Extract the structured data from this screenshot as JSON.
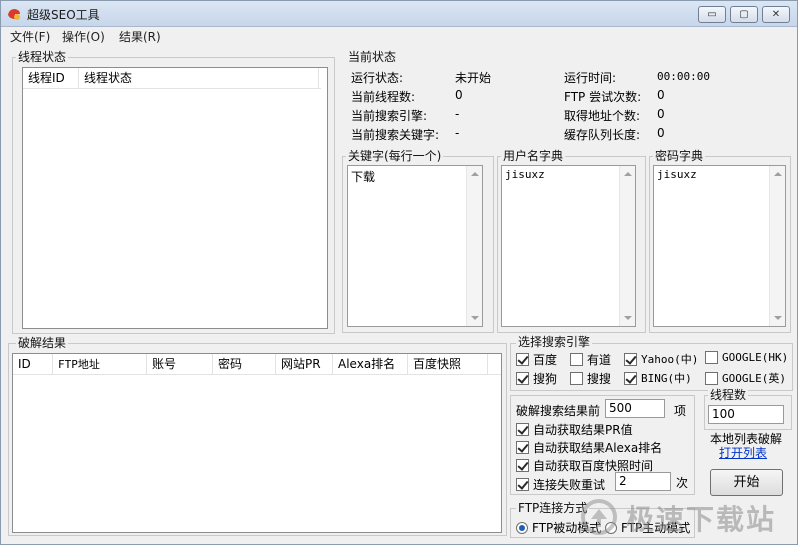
{
  "window": {
    "title": "超级SEO工具",
    "controls": {
      "minimize": "▭",
      "maximize": "▢",
      "close": "✕"
    }
  },
  "menu": [
    "文件(F)",
    "操作(O)",
    "结果(R)"
  ],
  "thread_status": {
    "label": "线程状态",
    "columns": [
      "线程ID",
      "线程状态"
    ]
  },
  "current_status": {
    "label": "当前状态",
    "left": [
      {
        "key": "运行状态:",
        "value": "未开始"
      },
      {
        "key": "当前线程数:",
        "value": "0"
      },
      {
        "key": "当前搜索引擎:",
        "value": "-"
      },
      {
        "key": "当前搜索关键字:",
        "value": "-"
      }
    ],
    "right": [
      {
        "key": "运行时间:",
        "value": "00:00:00"
      },
      {
        "key": "FTP 尝试次数:",
        "value": "0"
      },
      {
        "key": "取得地址个数:",
        "value": "0"
      },
      {
        "key": "缓存队列长度:",
        "value": "0"
      }
    ]
  },
  "keywords": {
    "label": "关键字(每行一个)",
    "value": "下载"
  },
  "username_dict": {
    "label": "用户名字典",
    "value": "jisuxz"
  },
  "password_dict": {
    "label": "密码字典",
    "value": "jisuxz"
  },
  "results": {
    "label": "破解结果",
    "columns": [
      "ID",
      "FTP地址",
      "账号",
      "密码",
      "网站PR",
      "Alexa排名",
      "百度快照"
    ]
  },
  "search_engines": {
    "label": "选择搜索引擎",
    "items": [
      {
        "label": "百度",
        "checked": true
      },
      {
        "label": "有道",
        "checked": false
      },
      {
        "label": "Yahoo(中)",
        "checked": true
      },
      {
        "label": "GOOGLE(HK)",
        "checked": false
      },
      {
        "label": "搜狗",
        "checked": true
      },
      {
        "label": "搜搜",
        "checked": false
      },
      {
        "label": "BING(中)",
        "checked": true
      },
      {
        "label": "GOOGLE(英)",
        "checked": false
      }
    ]
  },
  "crack_options": {
    "top_results_prefix": "破解搜索结果前",
    "top_results_value": "500",
    "top_results_suffix": "项",
    "opt_pr": {
      "label": "自动获取结果PR值",
      "checked": true
    },
    "opt_alexa": {
      "label": "自动获取结果Alexa排名",
      "checked": true
    },
    "opt_baidu": {
      "label": "自动获取百度快照时间",
      "checked": true
    },
    "opt_retry": {
      "label": "连接失败重试",
      "checked": true
    },
    "retry_value": "2",
    "retry_suffix": "次"
  },
  "thread_count": {
    "label": "线程数",
    "value": "100"
  },
  "local_list": {
    "label": "本地列表破解",
    "link": "打开列表"
  },
  "start_button": "开始",
  "ftp_mode": {
    "label": "FTP连接方式",
    "passive": {
      "label": "FTP被动模式",
      "selected": true
    },
    "active": {
      "label": "FTP主动模式",
      "selected": false
    }
  },
  "watermark": "极速下载站",
  "colors": {
    "titlebar": "#c7d6ea",
    "window_bg": "#f0f0f0",
    "link": "#0033cc"
  }
}
